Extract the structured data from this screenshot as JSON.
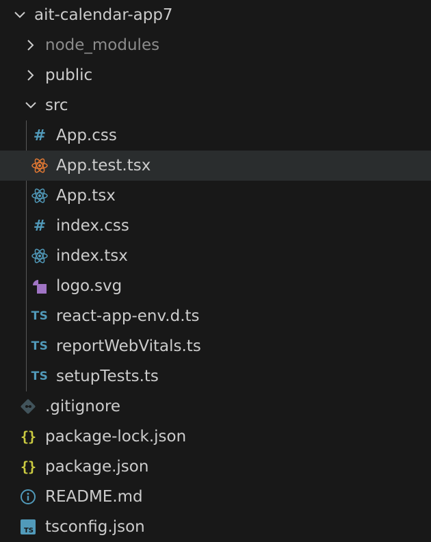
{
  "explorer": {
    "root": {
      "label": "ait-calendar-app7",
      "expanded": true
    },
    "items": [
      {
        "label": "node_modules",
        "type": "folder",
        "expanded": false,
        "dim": true
      },
      {
        "label": "public",
        "type": "folder",
        "expanded": false
      },
      {
        "label": "src",
        "type": "folder",
        "expanded": true
      },
      {
        "label": "App.css",
        "icon": "css-hash-icon"
      },
      {
        "label": "App.test.tsx",
        "icon": "react-test-icon",
        "selected": true
      },
      {
        "label": "App.tsx",
        "icon": "react-icon"
      },
      {
        "label": "index.css",
        "icon": "css-hash-icon"
      },
      {
        "label": "index.tsx",
        "icon": "react-icon"
      },
      {
        "label": "logo.svg",
        "icon": "svg-shapes-icon"
      },
      {
        "label": "react-app-env.d.ts",
        "icon": "ts-icon",
        "icon_text": "TS"
      },
      {
        "label": "reportWebVitals.ts",
        "icon": "ts-icon",
        "icon_text": "TS"
      },
      {
        "label": "setupTests.ts",
        "icon": "ts-icon",
        "icon_text": "TS"
      },
      {
        "label": ".gitignore",
        "icon": "git-icon"
      },
      {
        "label": "package-lock.json",
        "icon": "json-braces-icon",
        "icon_text": "{}"
      },
      {
        "label": "package.json",
        "icon": "json-braces-icon",
        "icon_text": "{}"
      },
      {
        "label": "README.md",
        "icon": "info-icon"
      },
      {
        "label": "tsconfig.json",
        "icon": "tsconfig-icon",
        "icon_text": "TS"
      }
    ]
  },
  "colors": {
    "background": "#181818",
    "selected_row": "#2a2d2e",
    "text": "#cccccc",
    "dim_text": "#8c8c8c",
    "ts_blue": "#519aba",
    "react_blue": "#519aba",
    "react_test_orange": "#e37933",
    "json_yellow": "#cbcb41",
    "svg_purple": "#a074c4",
    "git_gray": "#41535b"
  }
}
